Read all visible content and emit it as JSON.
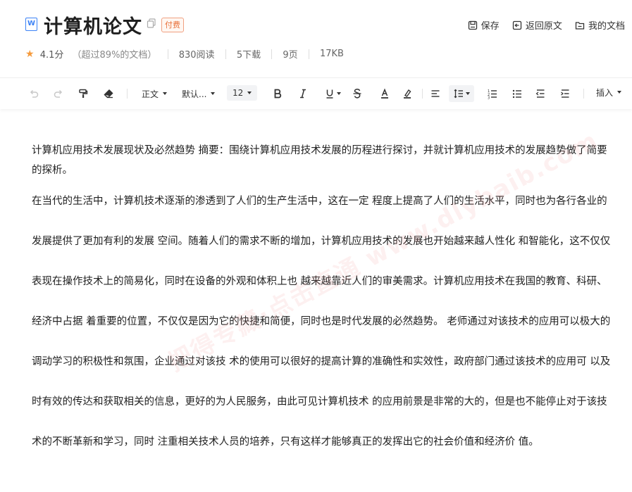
{
  "header": {
    "doc_type_icon": "word-doc-icon",
    "title": "计算机论文",
    "badge": "付费",
    "rating": "4.1分",
    "rating_percent": "（超过89%的文档）",
    "views": "830阅读",
    "downloads": "5下载",
    "pages": "9页",
    "size": "17KB",
    "actions": {
      "save": "保存",
      "back": "返回原文",
      "my_docs": "我的文档"
    }
  },
  "toolbar": {
    "style": "正文",
    "font": "默认...",
    "font_size": "12",
    "insert": "插入"
  },
  "content": {
    "paragraph1": "计算机应用技术发展现状及必然趋势 摘要：围绕计算机应用技术发展的历程进行探讨，并就计算机应用技术的发展趋势做了简要的探析。",
    "paragraph2": "在当代的生活中，计算机技术逐渐的渗透到了人们的生产生活中，这在一定 程度上提高了人们的生活水平，同时也为各行各业的发展提供了更加有利的发展 空间。随着人们的需求不断的增加，计算机应用技术的发展也开始越来越人性化 和智能化，这不仅仅表现在操作技术上的简易化，同时在设备的外观和体积上也 越来越靠近人们的审美需求。计算机应用技术在我国的教育、科研、经济中占据 着重要的位置，不仅仅是因为它的快捷和简便，同时也是时代发展的必然趋势。 老师通过对该技术的应用可以极大的调动学习的积极性和氛围，企业通过对该技 术的使用可以很好的提高计算的准确性和实效性，政府部门通过该技术的应用可 以及时有效的传达和获取相关的信息，更好的为人民服务，由此可见计算机技术 的应用前景是非常的大的，但是也不能停止对于该技术的不断革新和学习，同时 注重相关技术人员的培养，只有这样才能够真正的发挥出它的社会价值和经济价 值。"
  },
  "watermark": "把得专藏·点击直通 www.dlybaib.com",
  "colors": {
    "star": "#f59a3c",
    "badge": "#e8703a",
    "doc_icon": "#3b82f6"
  }
}
